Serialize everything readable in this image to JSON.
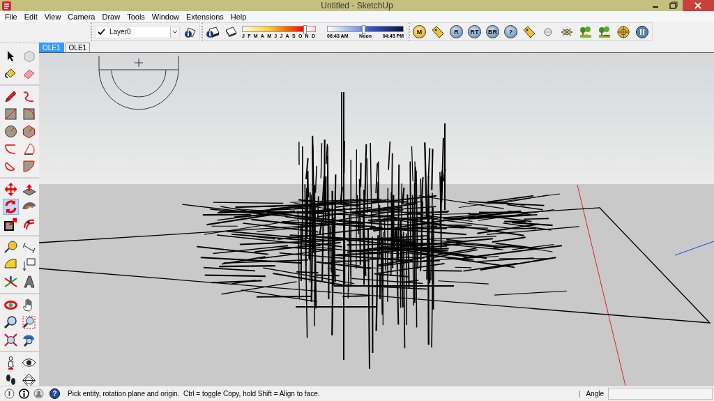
{
  "window": {
    "title": "Untitled - SketchUp"
  },
  "menu": [
    "File",
    "Edit",
    "View",
    "Camera",
    "Draw",
    "Tools",
    "Window",
    "Extensions",
    "Help"
  ],
  "layer": {
    "checked": true,
    "value": "Layer0"
  },
  "shadow": {
    "months": [
      "J",
      "F",
      "M",
      "A",
      "M",
      "J",
      "J",
      "A",
      "S",
      "O",
      "N",
      "D"
    ],
    "date_slider": {
      "level": 0.86
    },
    "time_slider": {
      "level": 0.47
    },
    "time_start": "06:43 AM",
    "time_mid": "Noon",
    "time_end": "04:45 PM"
  },
  "plugin_buttons": [
    {
      "kind": "orange-letter",
      "label": "M"
    },
    {
      "kind": "tag"
    },
    {
      "kind": "blue-letter",
      "label": "R"
    },
    {
      "kind": "blue-letter",
      "label": "RT"
    },
    {
      "kind": "blue-letter",
      "label": "BR"
    },
    {
      "kind": "blue-letter",
      "label": "?"
    },
    {
      "kind": "tag"
    },
    {
      "kind": "sphere"
    },
    {
      "kind": "plane"
    },
    {
      "kind": "trees"
    },
    {
      "kind": "trees-red"
    },
    {
      "kind": "target"
    },
    {
      "kind": "pause"
    }
  ],
  "tabs": [
    {
      "label": "OLE1",
      "selected": true
    },
    {
      "label": "OLE1",
      "selected": false
    }
  ],
  "tool_groups": [
    {
      "tools": [
        {
          "selected": false
        },
        {
          "selected": false
        },
        {
          "selected": false
        },
        {
          "selected": false
        }
      ]
    },
    {
      "tools": [
        {
          "selected": false
        },
        {
          "selected": false
        },
        {
          "selected": false
        },
        {
          "selected": false
        },
        {
          "selected": false
        },
        {
          "selected": false
        },
        {
          "selected": false
        },
        {
          "selected": false
        },
        {
          "selected": false
        },
        {
          "selected": false
        }
      ]
    },
    {
      "tools": [
        {
          "selected": false
        },
        {
          "selected": false
        },
        {
          "selected": true
        },
        {
          "selected": false
        },
        {
          "selected": false
        },
        {
          "selected": false
        }
      ]
    },
    {
      "tools": [
        {
          "selected": false
        },
        {
          "selected": false
        },
        {
          "selected": false
        },
        {
          "selected": false
        },
        {
          "selected": false
        },
        {
          "selected": false
        }
      ]
    },
    {
      "tools": [
        {
          "selected": false
        },
        {
          "selected": false
        },
        {
          "selected": false
        },
        {
          "selected": false
        },
        {
          "selected": false
        },
        {
          "selected": false
        }
      ]
    },
    {
      "tools": [
        {
          "selected": false
        },
        {
          "selected": false
        },
        {
          "selected": false
        },
        {
          "selected": false
        }
      ]
    }
  ],
  "status": {
    "help_glyph": "?",
    "hint": "Pick entity, rotation plane and origin.  Ctrl = toggle Copy, hold Shift = Align to face.",
    "measure_label": "Angle"
  }
}
